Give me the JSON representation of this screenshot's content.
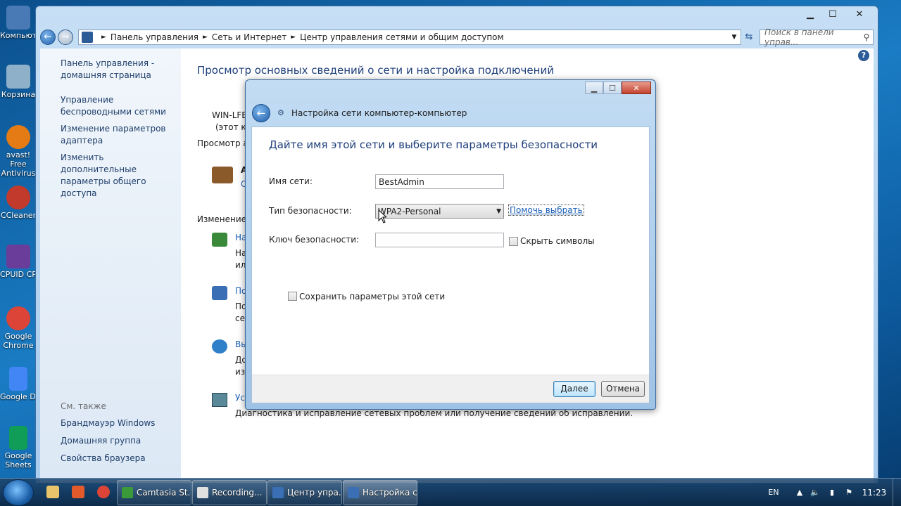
{
  "desktop": {
    "icons": [
      {
        "label": "Компьютер",
        "color": "#4a7ab5"
      },
      {
        "label": "Корзина",
        "color": "#8fb0c9"
      },
      {
        "label": "avast! Free Antivirus",
        "color": "#e47b14"
      },
      {
        "label": "CCleaner",
        "color": "#c23a2b"
      },
      {
        "label": "CPUID CPU-Z",
        "color": "#6a3d9a"
      },
      {
        "label": "Google Chrome",
        "color": "#db4437"
      },
      {
        "label": "Google Docs",
        "color": "#4285f4"
      },
      {
        "label": "Google Sheets",
        "color": "#0f9d58"
      }
    ]
  },
  "explorer": {
    "breadcrumb": [
      "Панель управления",
      "Сеть и Интернет",
      "Центр управления сетями и общим доступом"
    ],
    "search_placeholder": "Поиск в панели управ...",
    "sidebar": {
      "links": [
        "Панель управления - домашняя страница",
        "Управление беспроводными сетями",
        "Изменение параметров адаптера",
        "Изменить дополнительные параметры общего доступа"
      ],
      "see_also_label": "См. также",
      "see_also": [
        "Брандмауэр Windows",
        "Домашняя группа",
        "Свойства браузера"
      ]
    },
    "main": {
      "title": "Просмотр основных сведений о сети и настройка подключений",
      "computer_name": "WIN-LFBV",
      "this_computer": "(этот ко",
      "view_active": "Просмотр ак",
      "net_name": "А",
      "net_link": "С",
      "change_section": "Изменение с",
      "tasks": [
        {
          "link": "На",
          "desc1": "На",
          "desc2": "или"
        },
        {
          "link": "По",
          "desc1": "По",
          "desc2": "сет"
        },
        {
          "link": "Вы",
          "desc1": "До",
          "desc2": "изм"
        },
        {
          "link": "Ус",
          "desc1": "Диагностика и исправление сетевых проблем или получение сведений об исправлении."
        }
      ]
    }
  },
  "dialog": {
    "header_title": "Настройка сети компьютер-компьютер",
    "heading": "Дайте имя этой сети и выберите параметры безопасности",
    "network_name_label": "Имя сети:",
    "network_name_value": "BestAdmin",
    "security_type_label": "Тип безопасности:",
    "security_type_value": "WPA2-Personal",
    "help_choose_link": "Помочь выбрать",
    "security_key_label": "Ключ безопасности:",
    "security_key_value": "",
    "hide_chars_label": "Скрыть символы",
    "save_settings_label": "Сохранить параметры этой сети",
    "next_button": "Далее",
    "cancel_button": "Отмена"
  },
  "taskbar": {
    "tasks": [
      {
        "label": "Camtasia St...",
        "color": "#3a9a3a"
      },
      {
        "label": "Recording...",
        "color": "#e0e0e0"
      },
      {
        "label": "Центр упра...",
        "color": "#3b6fb5"
      },
      {
        "label": "Настройка с...",
        "color": "#3b6fb5"
      }
    ],
    "language": "EN",
    "clock": "11:23"
  }
}
